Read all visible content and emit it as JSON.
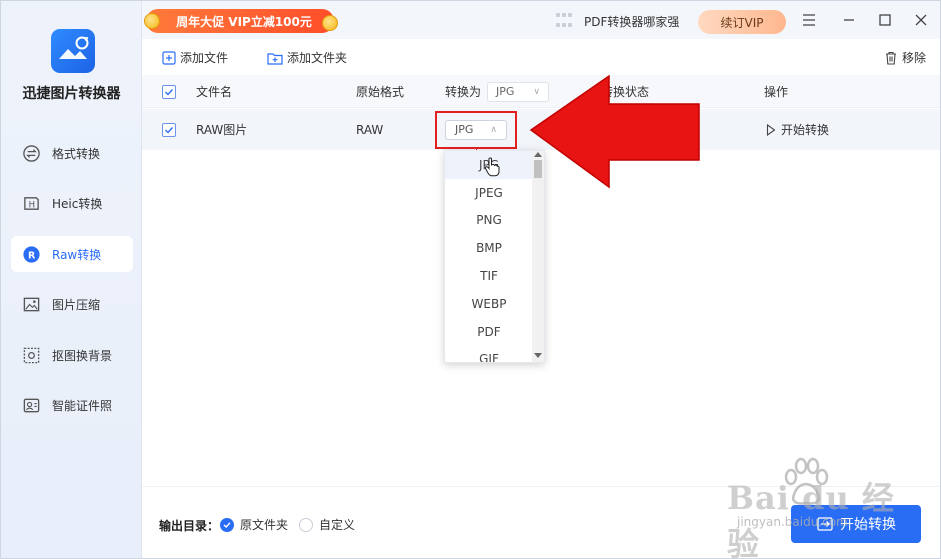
{
  "app": {
    "title": "迅捷图片转换器"
  },
  "titlebar": {
    "promo": "周年大促 VIP立减100元",
    "pdf_link": "PDF转换器哪家强",
    "vip_button": "续订VIP"
  },
  "sidebar": {
    "items": [
      {
        "label": "格式转换",
        "icon": "swap-icon",
        "active": false
      },
      {
        "label": "Heic转换",
        "icon": "heic-icon",
        "active": false
      },
      {
        "label": "Raw转换",
        "icon": "raw-icon",
        "active": true
      },
      {
        "label": "图片压缩",
        "icon": "image-icon",
        "active": false
      },
      {
        "label": "抠图换背景",
        "icon": "cutout-icon",
        "active": false
      },
      {
        "label": "智能证件照",
        "icon": "id-photo-icon",
        "active": false
      }
    ]
  },
  "toolbar": {
    "add_file": "添加文件",
    "add_folder": "添加文件夹",
    "remove": "移除"
  },
  "table": {
    "headers": {
      "filename": "文件名",
      "original_format": "原始格式",
      "convert_to": "转换为",
      "convert_to_value": "JPG",
      "status": "转换状态",
      "action": "操作"
    },
    "rows": [
      {
        "filename": "RAW图片",
        "format": "RAW",
        "target": "JPG",
        "status": "",
        "action": "开始转换"
      }
    ]
  },
  "dropdown": {
    "options": [
      "JPG",
      "JPEG",
      "PNG",
      "BMP",
      "TIF",
      "WEBP",
      "PDF",
      "GIF"
    ],
    "selected": "JPG"
  },
  "footer": {
    "output_label": "输出目录：",
    "option_original": "原文件夹",
    "option_custom": "自定义",
    "start_button": "开始转换"
  },
  "watermark": {
    "main": "Bai du 经验",
    "sub": "jingyan.baidu.com"
  },
  "colors": {
    "accent": "#2a6df5",
    "annotation_red": "#e32020",
    "promo": "#ff5a2e"
  }
}
